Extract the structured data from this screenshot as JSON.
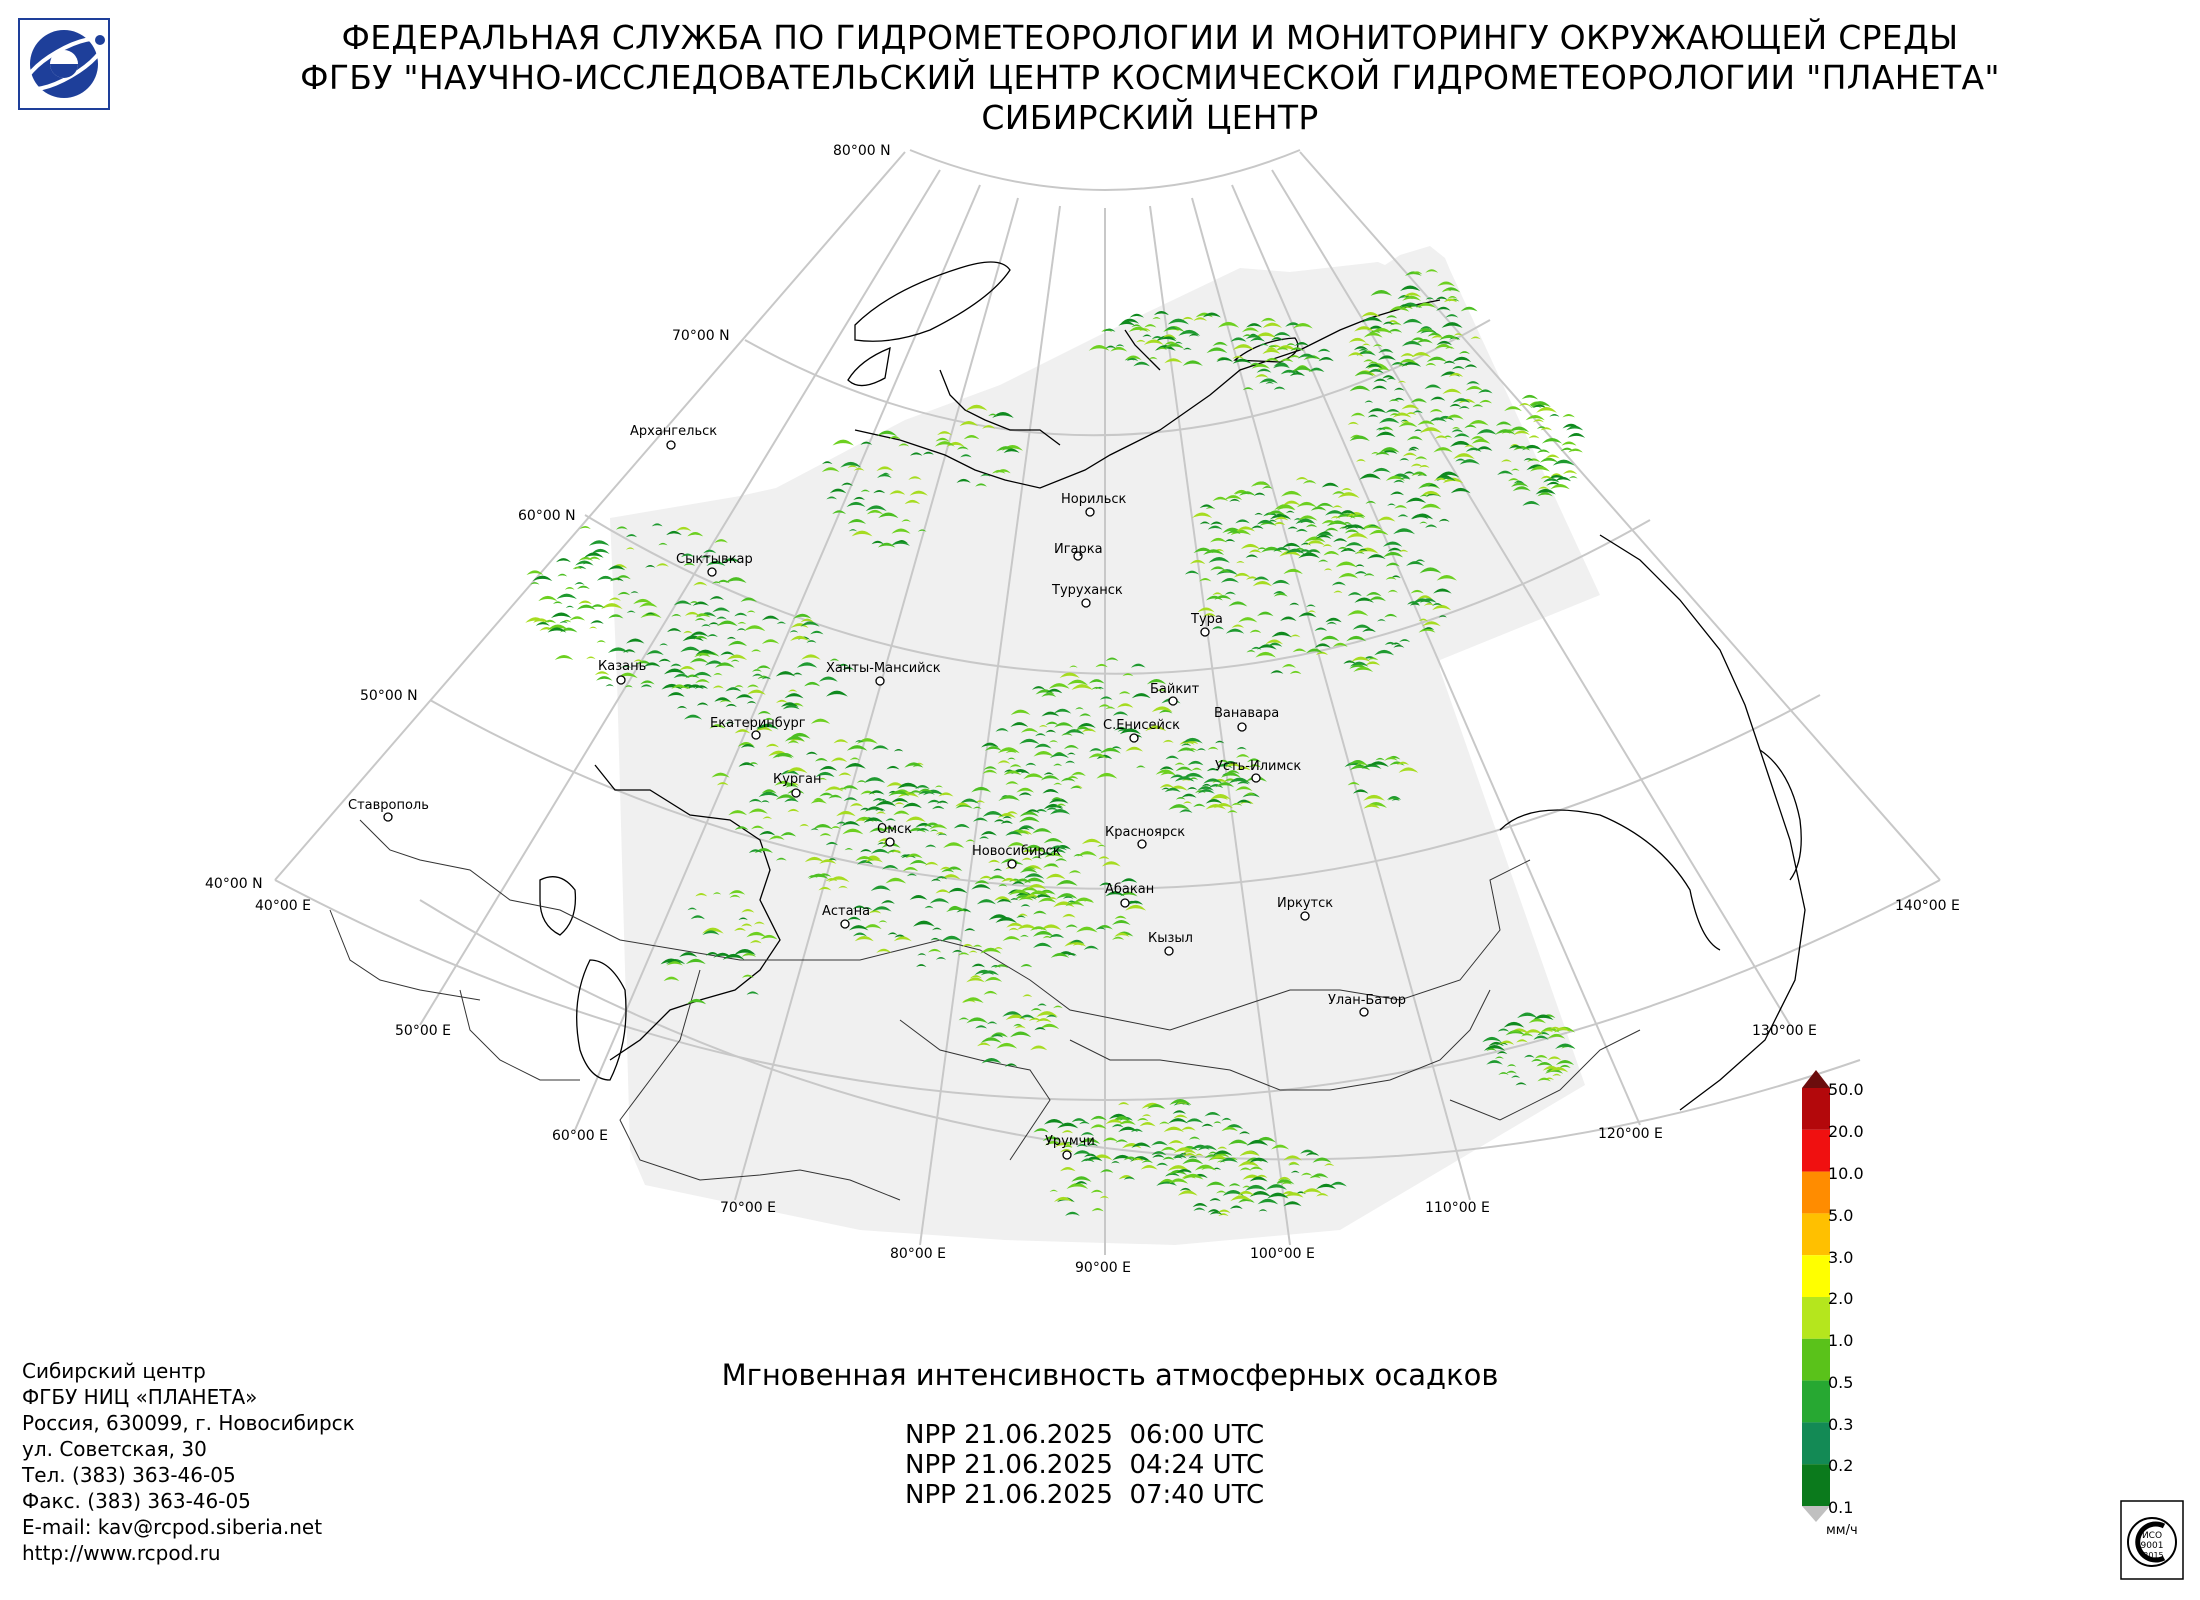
{
  "header": {
    "line1": "ФЕДЕРАЛЬНАЯ СЛУЖБА ПО ГИДРОМЕТЕОРОЛОГИИ И МОНИТОРИНГУ ОКРУЖАЮЩЕЙ СРЕДЫ",
    "line2": "ФГБУ \"НАУЧНО-ИССЛЕДОВАТЕЛЬСКИЙ ЦЕНТР КОСМИЧЕСКОЙ ГИДРОМЕТЕОРОЛОГИИ \"ПЛАНЕТА\"",
    "line3": "СИБИРСКИЙ ЦЕНТР"
  },
  "map": {
    "lat_labels": [
      "80°00 N",
      "70°00 N",
      "60°00 N",
      "50°00 N",
      "40°00 N"
    ],
    "lon_labels": [
      "40°00 E",
      "50°00 E",
      "60°00 E",
      "70°00 E",
      "80°00 E",
      "90°00 E",
      "100°00 E",
      "110°00 E",
      "120°00 E",
      "130°00 E",
      "140°00 E"
    ],
    "cities": [
      {
        "name": "Архангельск"
      },
      {
        "name": "Сыктывкар"
      },
      {
        "name": "Казань"
      },
      {
        "name": "Екатеринбург"
      },
      {
        "name": "Ханты-Мансийск"
      },
      {
        "name": "Курган"
      },
      {
        "name": "Омск"
      },
      {
        "name": "Ставрополь"
      },
      {
        "name": "Астана"
      },
      {
        "name": "Новосибирск"
      },
      {
        "name": "Норильск"
      },
      {
        "name": "Игарка"
      },
      {
        "name": "Туруханск"
      },
      {
        "name": "Тура"
      },
      {
        "name": "Байкит"
      },
      {
        "name": "Ванавара"
      },
      {
        "name": "С.Енисейск"
      },
      {
        "name": "Усть-Илимск"
      },
      {
        "name": "Красноярск"
      },
      {
        "name": "Абакан"
      },
      {
        "name": "Кызыл"
      },
      {
        "name": "Иркутск"
      },
      {
        "name": "Улан-Батор"
      },
      {
        "name": "Урумчи"
      }
    ]
  },
  "product": {
    "title": "Мгновенная интенсивность атмосферных осадков",
    "passes": [
      "NPP 21.06.2025  06:00 UTC",
      "NPP 21.06.2025  04:24 UTC",
      "NPP 21.06.2025  07:40 UTC"
    ]
  },
  "contact": {
    "lines": [
      "Сибирский центр",
      "ФГБУ НИЦ «ПЛАНЕТА»",
      "Россия, 630099, г. Новосибирск",
      "ул. Советская, 30",
      "Тел. (383) 363-46-05",
      "Факс. (383) 363-46-05",
      "E-mail: kav@rcpod.siberia.net",
      "http://www.rcpod.ru"
    ]
  },
  "legend": {
    "levels": [
      "50.0",
      "20.0",
      "10.0",
      "5.0",
      "3.0",
      "2.0",
      "1.0",
      "0.5",
      "0.3",
      "0.2",
      "0.1"
    ],
    "colors": [
      "#6b0d0d",
      "#b3080b",
      "#f01010",
      "#ff8c00",
      "#ffc000",
      "#ffff00",
      "#b5e61d",
      "#5ac21a",
      "#27a832",
      "#138a55",
      "#0b7a1c"
    ],
    "unit": "мм/ч"
  },
  "iso_badge": {
    "text1": "ИСО",
    "text2": "9001",
    "text3": "-2015"
  },
  "colors": {
    "coverage": "#f0f0f0",
    "grid": "#c8c8c8",
    "coast": "#000000",
    "precip_light": "#0f8a1e",
    "precip_mid": "#4cbf22",
    "precip_high": "#a6dc20"
  }
}
